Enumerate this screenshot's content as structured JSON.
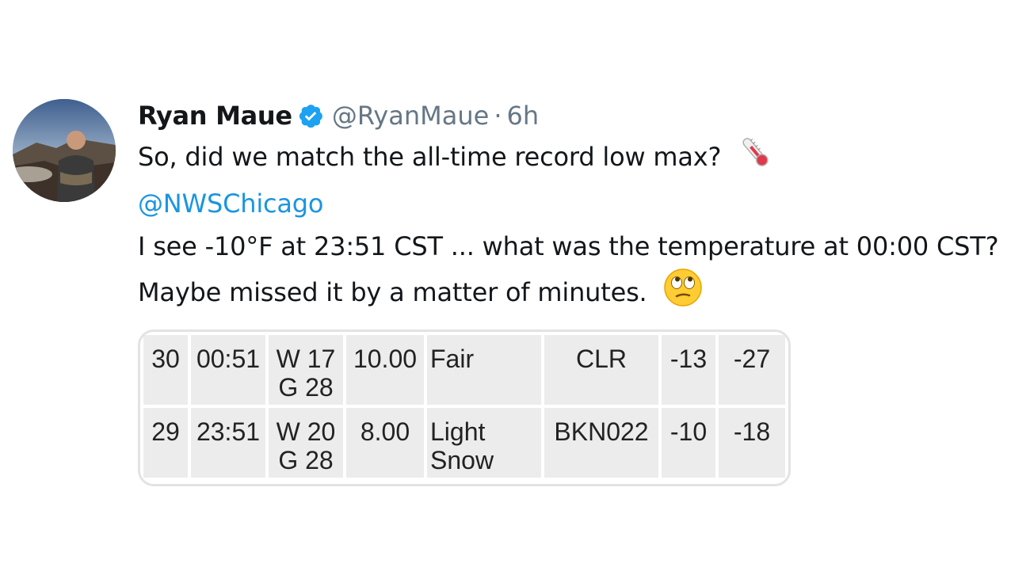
{
  "tweet": {
    "display_name": "Ryan Maue",
    "handle": "@RyanMaue",
    "separator": "·",
    "time": "6h",
    "verified": true,
    "avatar_icon": "profile-photo",
    "lines": [
      "So, did we match the all-time record low max?",
      "@NWSChicago",
      "I see -10°F at 23:51 CST ... what was the temperature at 00:00 CST?",
      "Maybe missed it by a matter of minutes."
    ],
    "emojis": [
      "thermometer-emoji",
      "face-with-rolling-eyes-emoji"
    ]
  },
  "table": {
    "rows": [
      {
        "day": "30",
        "time": "00:51",
        "wind": "W 17",
        "gust": "G 28",
        "visibility": "10.00",
        "weather": "Fair",
        "weather2": "",
        "sky": "CLR",
        "temp": "-13",
        "dewpoint": "-27"
      },
      {
        "day": "29",
        "time": "23:51",
        "wind": "W 20",
        "gust": "G 28",
        "visibility": "8.00",
        "weather": "Light",
        "weather2": "Snow",
        "sky": "BKN022",
        "temp": "-10",
        "dewpoint": "-18"
      }
    ]
  },
  "colors": {
    "mention": "#1b95e0",
    "verified": "#1da1f2",
    "muted": "#657786",
    "cell_bg": "#ececec"
  }
}
